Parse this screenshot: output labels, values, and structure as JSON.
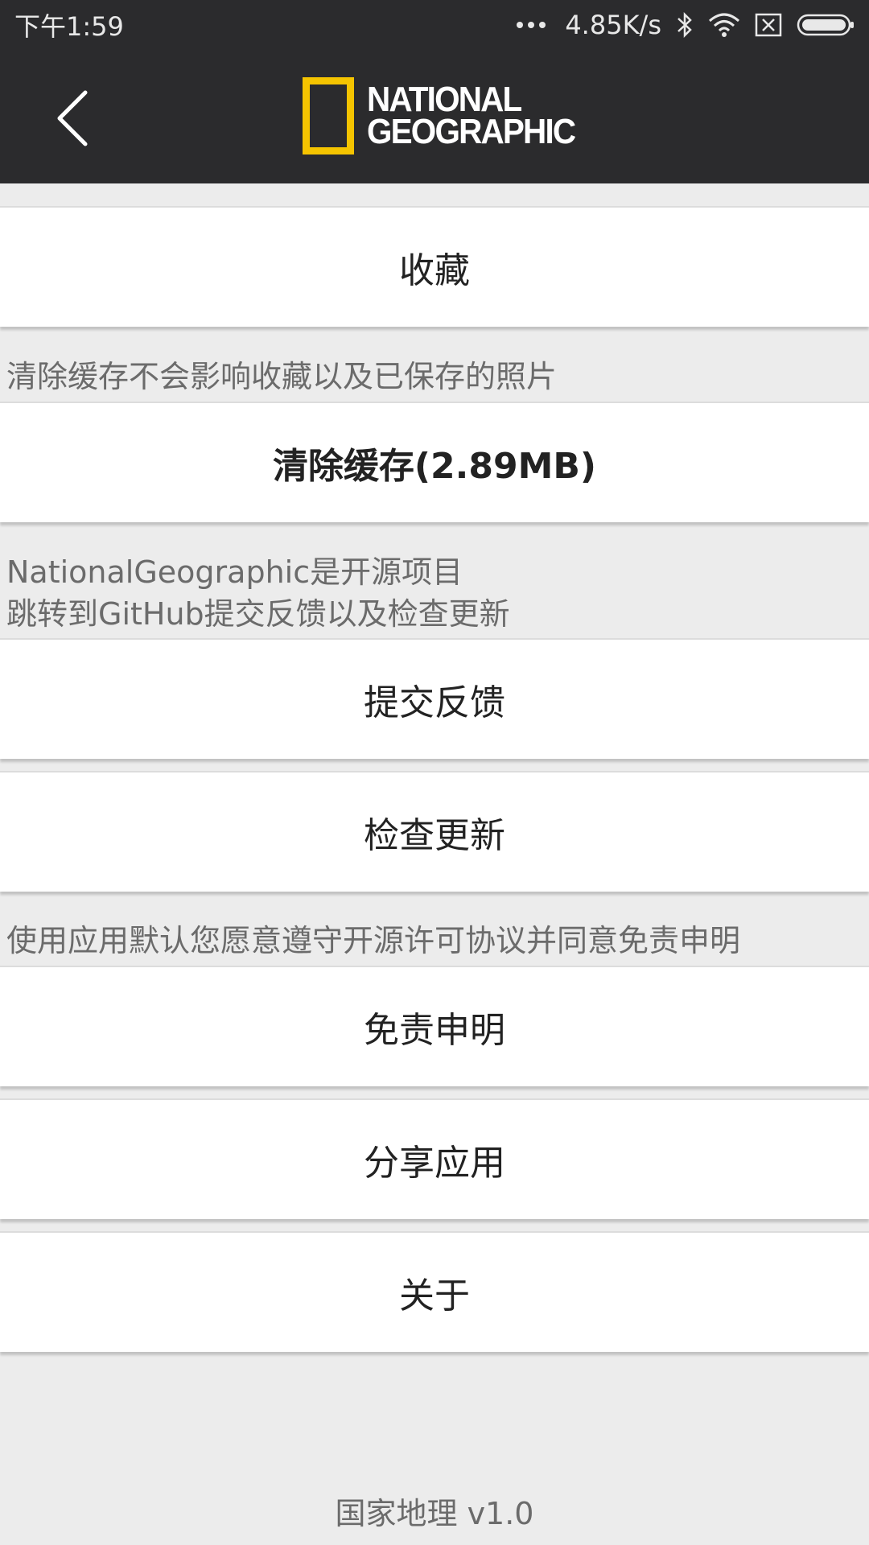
{
  "status_bar": {
    "time": "下午1:59",
    "network_speed": "4.85K/s",
    "icons": [
      "more-dots-icon",
      "bluetooth-icon",
      "wifi-icon",
      "sim-off-icon",
      "battery-icon"
    ]
  },
  "header": {
    "back_icon": "chevron-left-icon",
    "logo_line1": "NATIONAL",
    "logo_line2": "GEOGRAPHIC",
    "logo_color": "#f5c400"
  },
  "items": {
    "favorites": "收藏",
    "cache_note": "清除缓存不会影响收藏以及已保存的照片",
    "clear_cache": "清除缓存(2.89MB)",
    "opensource_note_line1": "NationalGeographic是开源项目",
    "opensource_note_line2": "跳转到GitHub提交反馈以及检查更新",
    "feedback": "提交反馈",
    "check_update": "检查更新",
    "license_note": "使用应用默认您愿意遵守开源许可协议并同意免责申明",
    "disclaimer": "免责申明",
    "share": "分享应用",
    "about": "关于"
  },
  "footer": {
    "version": "国家地理 v1.0"
  }
}
